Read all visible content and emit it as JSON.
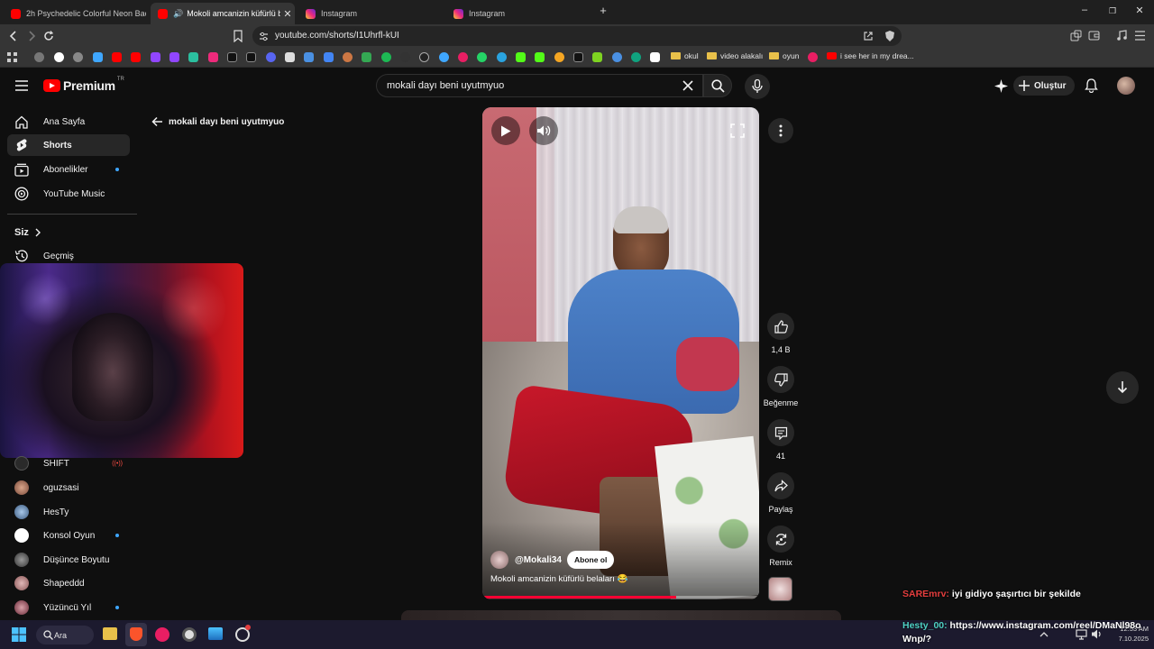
{
  "browser": {
    "tabs": [
      {
        "label": "2h Psychedelic Colorful Neon Backgro",
        "favicon": "youtube-icon",
        "active": false
      },
      {
        "label": "Mokoli amcanizin küfürlü belal",
        "favicon": "youtube-icon",
        "active": true
      },
      {
        "label": "Instagram",
        "favicon": "instagram-icon",
        "active": false
      },
      {
        "label": "Instagram",
        "favicon": "instagram-icon",
        "active": false
      }
    ],
    "url": "youtube.com/shorts/I1Uhrfl-kUI",
    "bookmarks": {
      "folders": [
        "okul",
        "video alakalı",
        "oyun"
      ],
      "last_bookmark": "i see her in my drea..."
    }
  },
  "youtube": {
    "logo_text": "Premium",
    "logo_region": "TR",
    "search_query": "mokali dayı beni uyutmyuo",
    "create_label": "Oluştur",
    "back_label": "mokali dayı beni uyutmyuo",
    "sidebar": {
      "main": [
        {
          "label": "Ana Sayfa",
          "icon": "home-icon"
        },
        {
          "label": "Shorts",
          "icon": "shorts-icon"
        },
        {
          "label": "Abonelikler",
          "icon": "subscriptions-icon"
        },
        {
          "label": "YouTube Music",
          "icon": "youtube-music-icon"
        }
      ],
      "you_label": "Siz",
      "history_label": "Geçmiş",
      "subscriptions": [
        {
          "label": "SHIFT",
          "live": true
        },
        {
          "label": "oguzsasi"
        },
        {
          "label": "HesTy"
        },
        {
          "label": "Konsol Oyun",
          "dot": true
        },
        {
          "label": "Düşünce Boyutu"
        },
        {
          "label": "Shapeddd"
        },
        {
          "label": "Yüzüncü Yıl",
          "dot": true
        }
      ]
    },
    "short": {
      "channel": "@Mokali34",
      "subscribe_label": "Abone ol",
      "title": "Mokoli amcanizin küfürlü belaları 😂"
    },
    "actions": {
      "like_count": "1,4 B",
      "dislike_label": "Beğenme",
      "comment_count": "41",
      "share_label": "Paylaş",
      "remix_label": "Remix"
    }
  },
  "stream_chat": [
    {
      "user": "SAREmrv:",
      "message": "iyi gidiyo şaşırtıcı bir şekilde",
      "color": "#e53e3e"
    },
    {
      "user": "Hesty_00:",
      "message": "https://www.instagram.com/reel/DMaNl98o",
      "message_cont": "Wnp/?",
      "color": "#4fd1c5"
    }
  ],
  "taskbar": {
    "search_label": "Ara",
    "time": "12:53 AM",
    "date": "7.10.2025"
  }
}
